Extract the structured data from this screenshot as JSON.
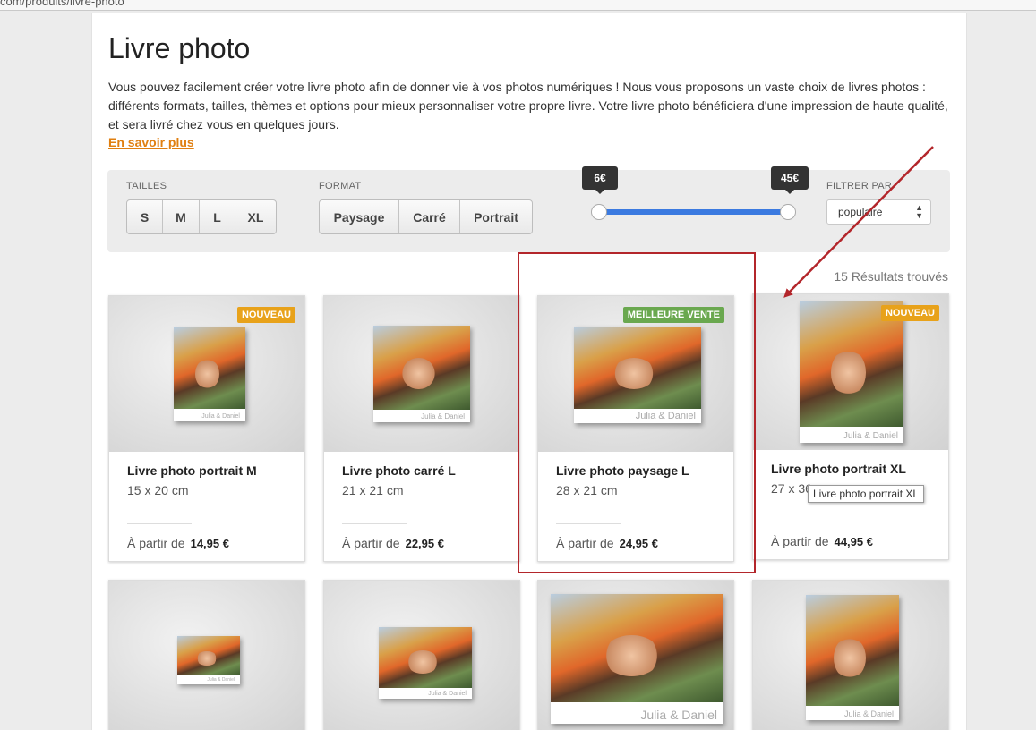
{
  "browser": {
    "url": "com/produits/livre-photo"
  },
  "page": {
    "title": "Livre photo",
    "description": "Vous pouvez facilement créer votre livre photo afin de donner vie à vos photos numériques ! Nous vous proposons un vaste choix de livres photos : différents formats, tailles, thèmes et options pour mieux personnaliser votre propre livre. Votre livre photo bénéficiera d'une impression de haute qualité, et sera livré chez vous en quelques jours.",
    "more_link": "En savoir plus"
  },
  "filters": {
    "sizes_label": "TAILLES",
    "sizes": [
      "S",
      "M",
      "L",
      "XL"
    ],
    "format_label": "FORMAT",
    "formats": [
      "Paysage",
      "Carré",
      "Portrait"
    ],
    "price_min": "6€",
    "price_max": "45€",
    "sort_label": "FILTRER PAR",
    "sort_value": "populaire"
  },
  "results_count": "15 Résultats trouvés",
  "price_prefix": "À partir de",
  "cover_caption": "Julia & Daniel",
  "products": [
    {
      "title": "Livre photo portrait M",
      "size": "15 x 20 cm",
      "price": "14,95 €",
      "badge": "NOUVEAU"
    },
    {
      "title": "Livre photo carré L",
      "size": "21 x 21 cm",
      "price": "22,95 €",
      "badge": ""
    },
    {
      "title": "Livre photo paysage L",
      "size": "28 x 21 cm",
      "price": "24,95 €",
      "badge": "MEILLEURE VENTE"
    },
    {
      "title": "Livre photo portrait XL",
      "size": "27 x 36 cm",
      "price": "44,95 €",
      "badge": "NOUVEAU"
    }
  ],
  "tooltip": "Livre photo portrait XL",
  "colors": {
    "accent_orange": "#e07f10",
    "badge_new": "#e8a21a",
    "badge_best": "#6aa84f",
    "slider": "#3b7ae0",
    "annotation_red": "#b3262b"
  }
}
